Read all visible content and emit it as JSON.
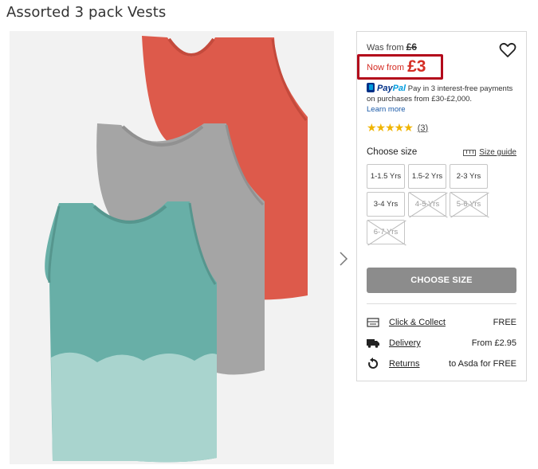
{
  "product": {
    "title": "Assorted 3 pack Vests"
  },
  "pricing": {
    "was_label": "Was from",
    "was_price": "£6",
    "now_label": "Now from",
    "now_price": "£3"
  },
  "paypal": {
    "logo_pay": "Pay",
    "logo_pal": "Pal",
    "text": "Pay in 3 interest-free payments on purchases from £30-£2,000.",
    "learn_more": "Learn more"
  },
  "rating": {
    "stars": "★★★★★",
    "value": 4.5,
    "count": "(3)"
  },
  "sizes": {
    "label": "Choose size",
    "guide_label": "Size guide",
    "options": [
      {
        "label": "1-1.5 Yrs",
        "available": true
      },
      {
        "label": "1.5-2 Yrs",
        "available": true
      },
      {
        "label": "2-3 Yrs",
        "available": true
      },
      {
        "label": "3-4 Yrs",
        "available": true
      },
      {
        "label": "4-5 Yrs",
        "available": false
      },
      {
        "label": "5-6 Yrs",
        "available": false
      },
      {
        "label": "6-7 Yrs",
        "available": false
      }
    ]
  },
  "cta": {
    "choose_size": "CHOOSE SIZE"
  },
  "delivery": {
    "click_collect_label": "Click & Collect",
    "click_collect_value": "FREE",
    "delivery_label": "Delivery",
    "delivery_value": "From £2.95",
    "returns_label": "Returns",
    "returns_value": "to Asda for FREE"
  },
  "colors": {
    "sale_red": "#d52d24",
    "highlight_border": "#b3091b",
    "button_grey": "#8c8c8c",
    "star_gold": "#f0b400",
    "paypal_dark": "#003087",
    "paypal_light": "#009cde",
    "vest_red": "#dd5a4b",
    "vest_grey": "#a5a5a5",
    "vest_teal": "#68afa7"
  },
  "icons": {
    "wishlist": "heart-outline-icon",
    "next": "chevron-right-icon",
    "size_guide": "ruler-icon",
    "click_collect": "store-icon",
    "delivery": "truck-icon",
    "returns": "returns-arrow-icon"
  }
}
